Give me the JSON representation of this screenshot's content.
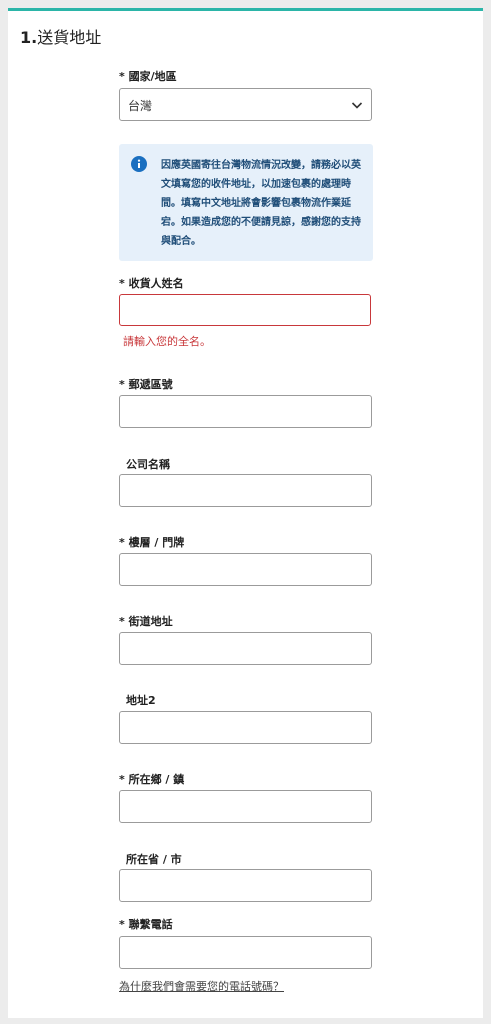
{
  "section": {
    "number": "1.",
    "title": "送貨地址"
  },
  "country": {
    "label": "* 國家/地區",
    "value": "台灣"
  },
  "notice": {
    "text": "因應英國寄往台灣物流情況改變，請務必以英文填寫您的收件地址，以加速包裹的處理時間。填寫中文地址將會影響包裹物流作業延宕。如果造成您的不便請見諒，感謝您的支持與配合。"
  },
  "fields": {
    "recipient_name": {
      "label": "* 收貨人姓名",
      "value": "",
      "error": "請輸入您的全名。"
    },
    "postal_code": {
      "label": "* 郵遞區號",
      "value": ""
    },
    "company": {
      "label": "公司名稱",
      "value": ""
    },
    "floor": {
      "label": "* 樓層 / 門牌",
      "value": ""
    },
    "street": {
      "label": "* 街道地址",
      "value": ""
    },
    "address2": {
      "label": "地址2",
      "value": ""
    },
    "township": {
      "label": "* 所在鄉 / 鎮",
      "value": ""
    },
    "province": {
      "label": "所在省 / 市",
      "value": ""
    },
    "phone": {
      "label": "* 聯繫電話",
      "value": ""
    }
  },
  "phone_help_link": "為什麼我們會需要您的電話號碼？",
  "colors": {
    "accent": "#2bb5a8",
    "error": "#c8383b",
    "info_bg": "#e6f0fa",
    "info_icon": "#1a6fc0"
  },
  "icons": {
    "info": "info-circle-icon",
    "dropdown": "chevron-down-icon"
  }
}
